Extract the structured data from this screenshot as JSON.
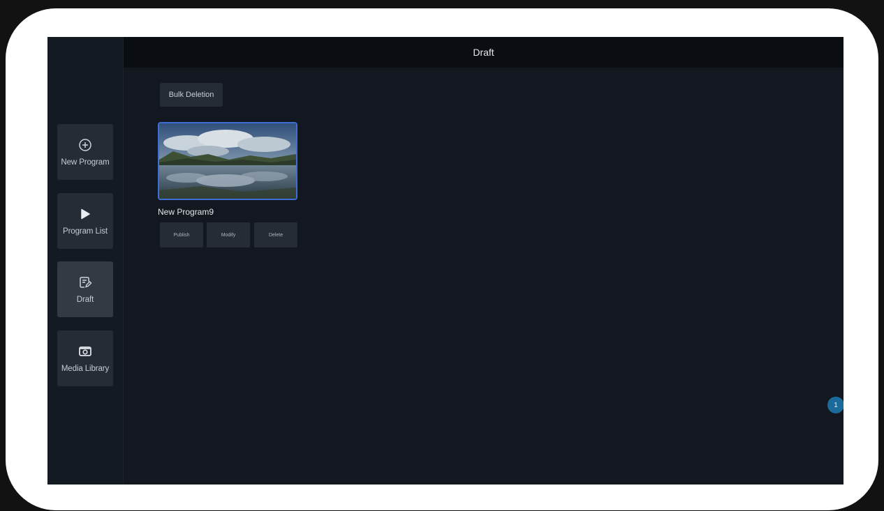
{
  "header": {
    "title": "Draft"
  },
  "sidebar": {
    "items": [
      {
        "label": "New Program",
        "icon": "plus-circle-icon"
      },
      {
        "label": "Program List",
        "icon": "play-icon"
      },
      {
        "label": "Draft",
        "icon": "edit-document-icon",
        "active": true
      },
      {
        "label": "Media Library",
        "icon": "media-library-icon"
      }
    ]
  },
  "toolbar": {
    "bulk_delete_label": "Bulk Deletion"
  },
  "drafts": [
    {
      "title": "New Program9",
      "thumbnail": "landscape-clouds-lake",
      "actions": {
        "publish": "Publish",
        "modify": "Modify",
        "delete": "Delete"
      }
    }
  ],
  "pagination": {
    "current_page": "1"
  },
  "colors": {
    "accent": "#3d6fd6",
    "badge": "#1c6a9a",
    "surface": "#131820"
  }
}
